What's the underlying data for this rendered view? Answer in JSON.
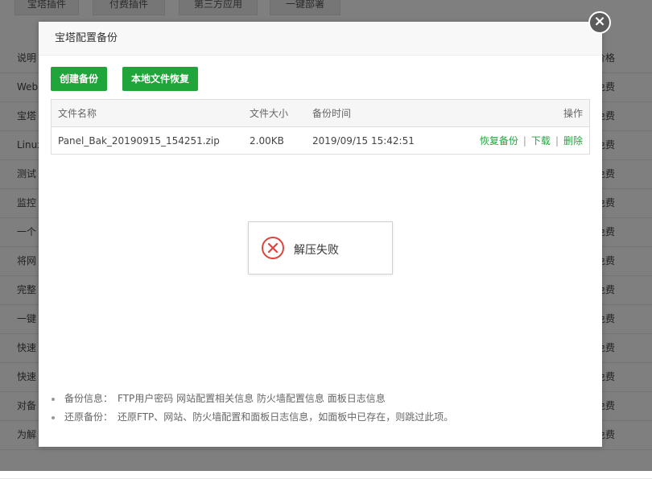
{
  "background": {
    "tabs": [
      "宝塔插件",
      "付费插件",
      "第三方应用",
      "一键部署"
    ],
    "rows": [
      {
        "left": "说明",
        "right": "价格"
      },
      {
        "left": "Web",
        "right": "免费"
      },
      {
        "left": "宝塔",
        "right": "免费"
      },
      {
        "left": "Linux",
        "right": "免费"
      },
      {
        "left": "测试",
        "right": "免费"
      },
      {
        "left": "监控",
        "right": "免费"
      },
      {
        "left": "一个",
        "right": "免费"
      },
      {
        "left": "将网",
        "right": "免费"
      },
      {
        "left": "完整",
        "right": "免费"
      },
      {
        "left": "一键",
        "right": "免费"
      },
      {
        "left": "快速",
        "right": "免费"
      },
      {
        "left": "快速",
        "right": "免费"
      },
      {
        "left": "对备",
        "right": "免费"
      },
      {
        "left": "为解",
        "right": "免费"
      },
      {
        "left": "",
        "right": ""
      }
    ]
  },
  "dialog": {
    "title": "宝塔配置备份",
    "create_backup_label": "创建备份",
    "local_restore_label": "本地文件恢复",
    "table": {
      "headers": [
        "文件名称",
        "文件大小",
        "备份时间",
        "操作"
      ],
      "rows": [
        {
          "name": "Panel_Bak_20190915_154251.zip",
          "size": "2.00KB",
          "time": "2019/09/15 15:42:51",
          "restore": "恢复备份",
          "download": "下载",
          "delete": "删除"
        }
      ],
      "separator": "|"
    },
    "toast": {
      "message": "解压失败",
      "icon": "error-x-circle-icon"
    },
    "notes": [
      {
        "label": "备份信息：",
        "text": "FTP用户密码 网站配置相关信息 防火墙配置信息 面板日志信息"
      },
      {
        "label": "还原备份：",
        "text": "还原FTP、网站、防火墙配置和面板日志信息，如面板中已存在，则跳过此项。"
      }
    ]
  },
  "colors": {
    "accent": "#20a53a",
    "error": "#e0433e",
    "close_bg": "#5b5b5b"
  }
}
